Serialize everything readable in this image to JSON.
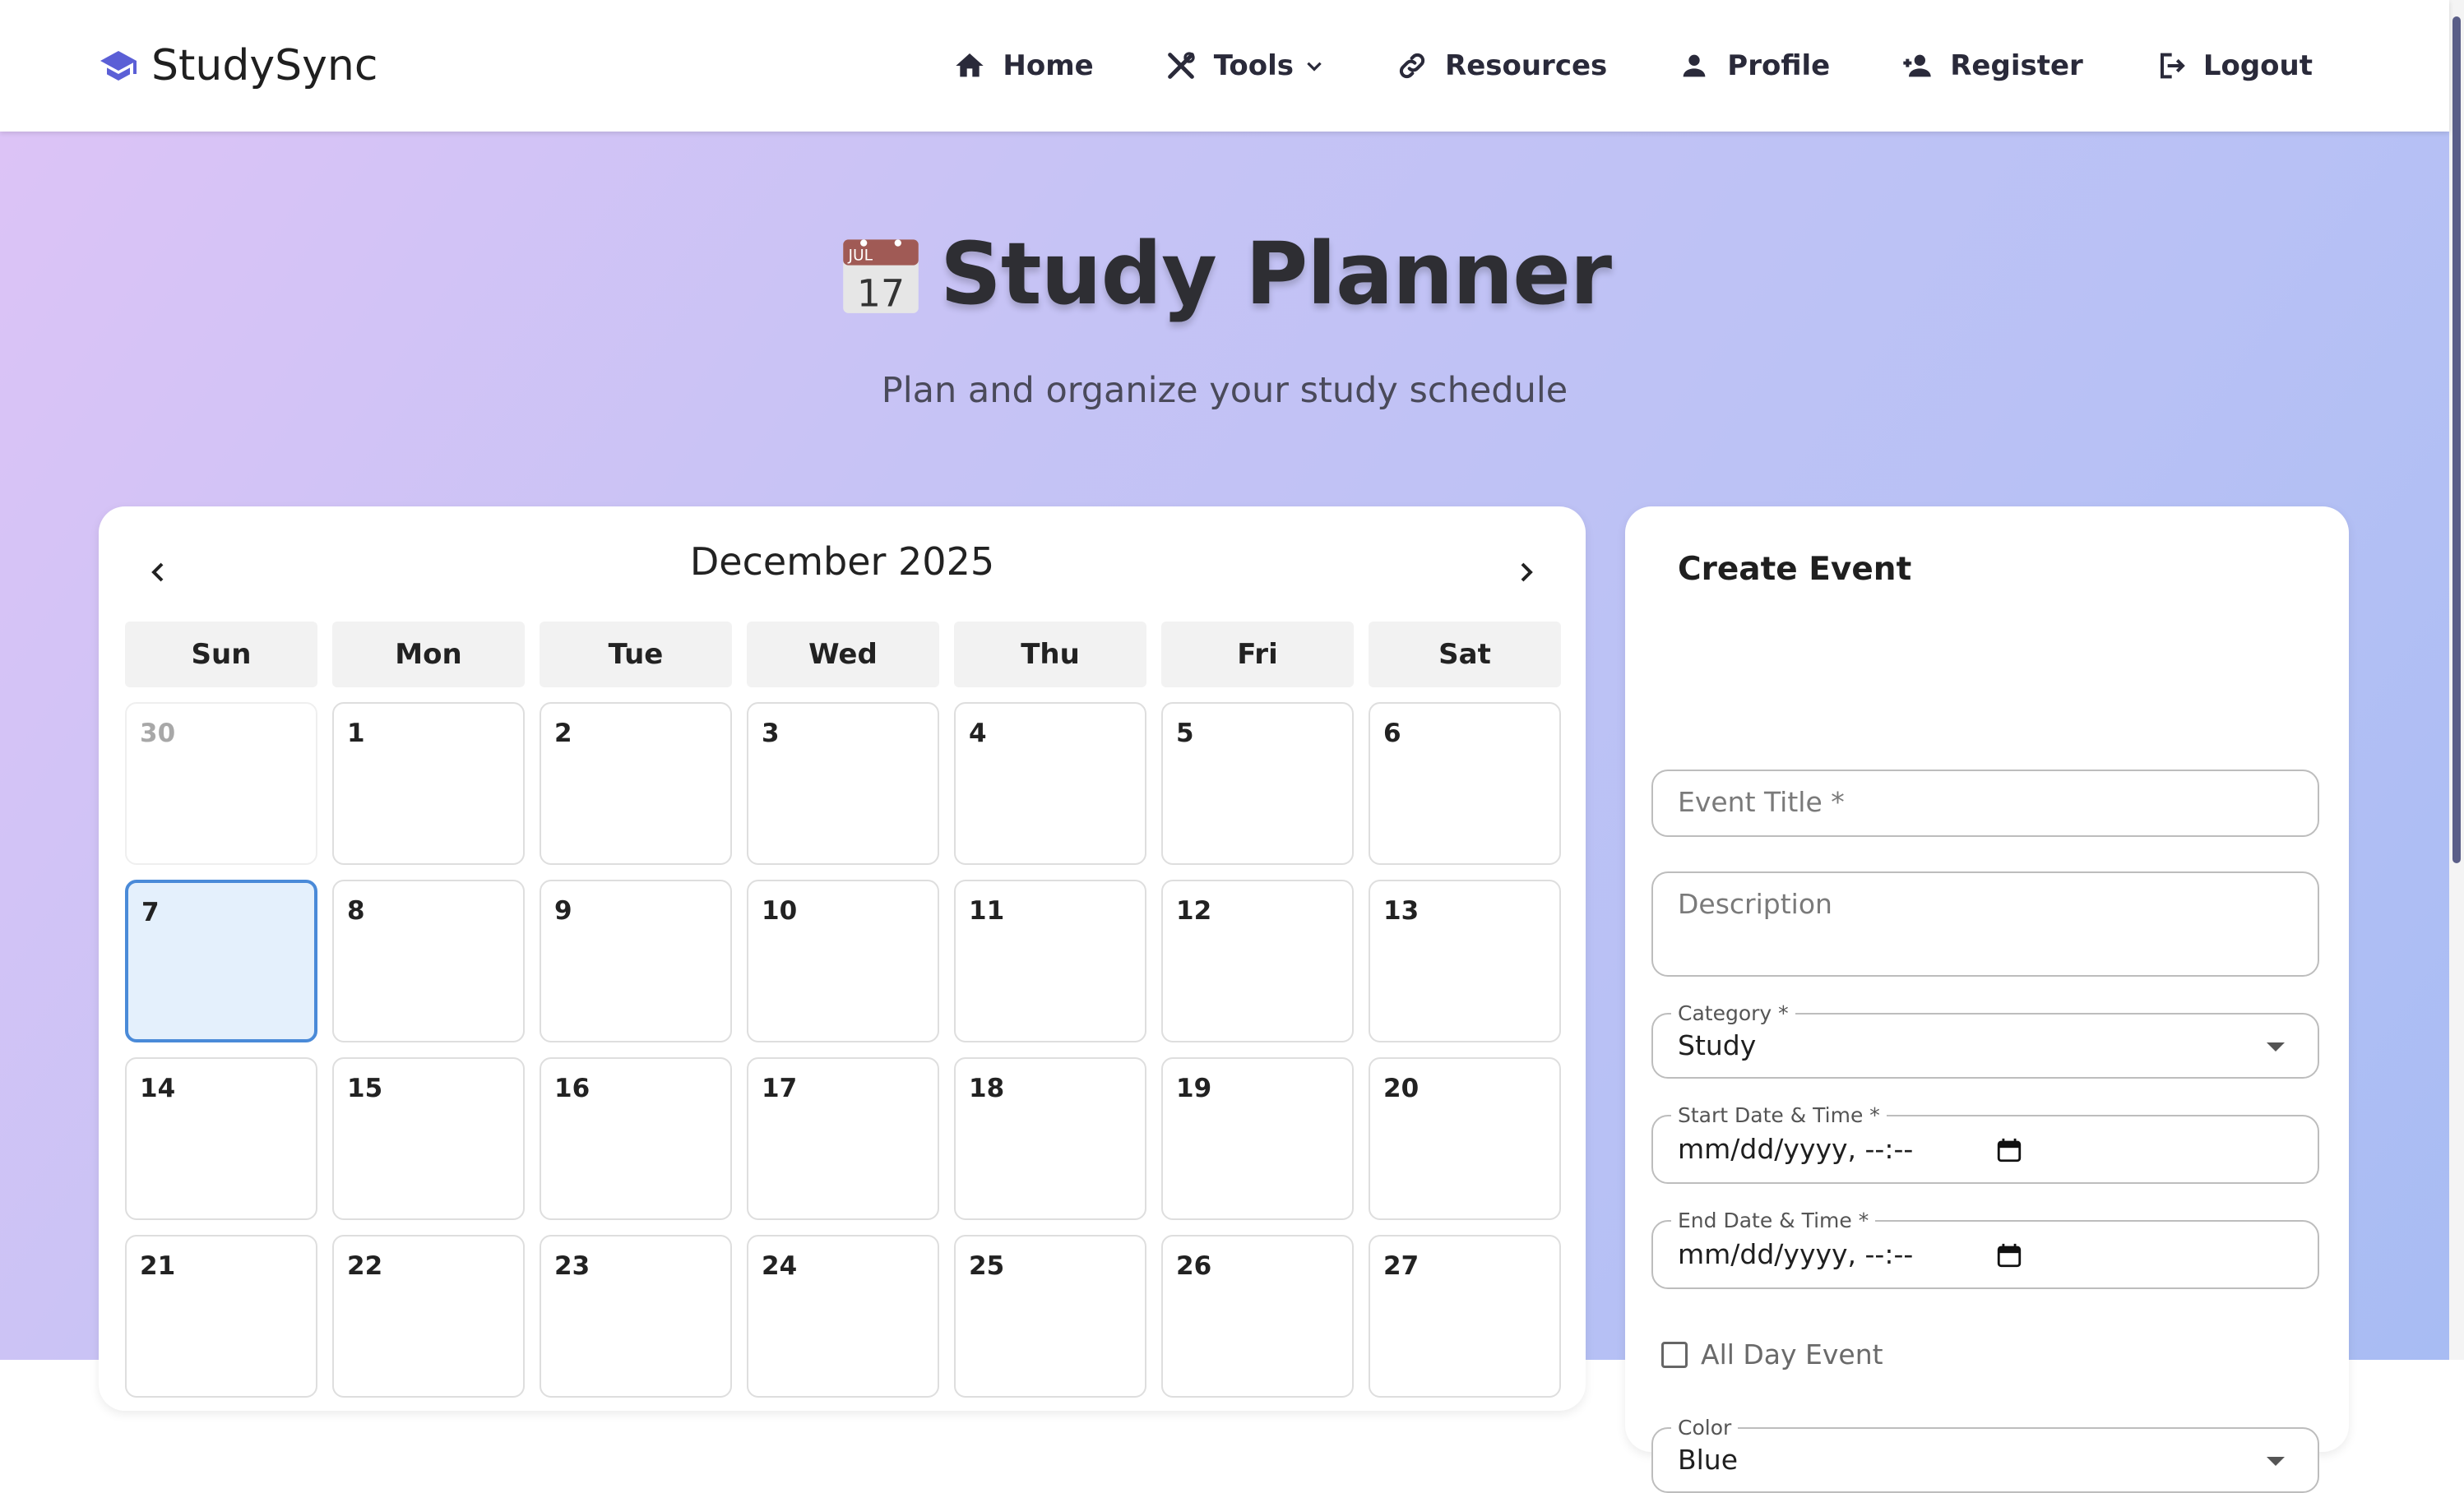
{
  "brand": {
    "name": "StudySync",
    "icon": "graduation-cap-icon"
  },
  "nav": {
    "items": [
      {
        "label": "Home",
        "icon": "home-icon"
      },
      {
        "label": "Tools",
        "icon": "tools-icon"
      },
      {
        "label": "Resources",
        "icon": "link-icon"
      },
      {
        "label": "Profile",
        "icon": "user-icon"
      },
      {
        "label": "Register",
        "icon": "user-plus-icon"
      },
      {
        "label": "Logout",
        "icon": "logout-icon"
      }
    ]
  },
  "page": {
    "title": "Study Planner",
    "subtitle": "Plan and organize your study schedule",
    "title_icon": "calendar-emoji-icon"
  },
  "calendar": {
    "month_label": "December 2025",
    "weekdays": [
      "Sun",
      "Mon",
      "Tue",
      "Wed",
      "Thu",
      "Fri",
      "Sat"
    ],
    "days": [
      "30",
      "1",
      "2",
      "3",
      "4",
      "5",
      "6",
      "7",
      "8",
      "9",
      "10",
      "11",
      "12",
      "13",
      "14",
      "15",
      "16",
      "17",
      "18",
      "19",
      "20",
      "21",
      "22",
      "23",
      "24",
      "25",
      "26",
      "27"
    ],
    "other_month_days": [
      "30"
    ],
    "selected_day": "7"
  },
  "form": {
    "title": "Create Event",
    "event_title_placeholder": "Event Title *",
    "description_placeholder": "Description",
    "category_label": "Category *",
    "category_value": "Study",
    "start_label": "Start Date & Time *",
    "start_value": "mm/dd/yyyy, --:--",
    "end_label": "End Date & Time *",
    "end_value": "mm/dd/yyyy, --:--",
    "all_day_label": "All Day Event",
    "all_day_checked": false,
    "color_label": "Color",
    "color_value": "Blue"
  },
  "colors": {
    "accent": "#5b5fd6",
    "today_border": "#4a8ad8",
    "today_bg": "#e4f0fc",
    "gradient_start": "#dcc3f6",
    "gradient_end": "#a8bcf3"
  }
}
